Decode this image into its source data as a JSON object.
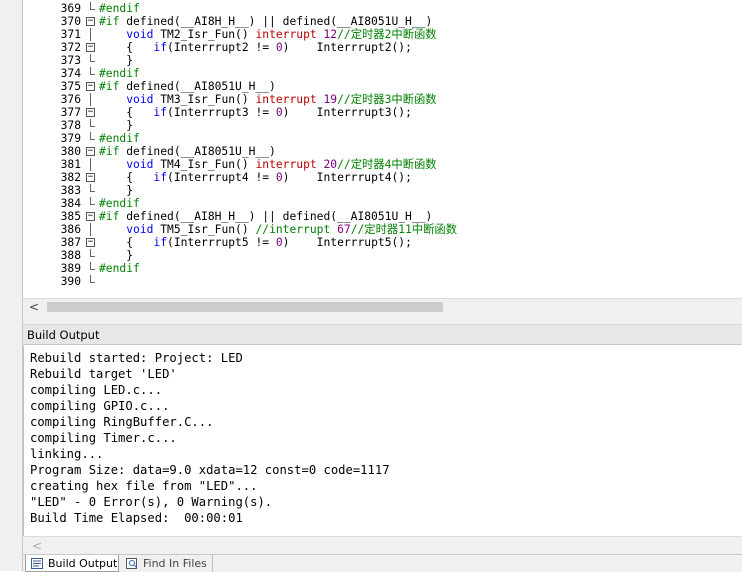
{
  "editor": {
    "lines": [
      {
        "num": "369",
        "code": [
          {
            "t": "#endif",
            "c": "pp"
          }
        ]
      },
      {
        "num": "370",
        "code": [
          {
            "t": "#if",
            "c": "pp"
          },
          {
            "t": " defined(__AI8H_H__) || defined(__AI8051U_H__)"
          }
        ]
      },
      {
        "num": "371",
        "code": [
          {
            "t": "    "
          },
          {
            "t": "void",
            "c": "kw"
          },
          {
            "t": " TM2_Isr_Fun() "
          },
          {
            "t": "interrupt",
            "c": "ir"
          },
          {
            "t": " "
          },
          {
            "t": "12",
            "c": "num"
          },
          {
            "t": "//定时器2中断函数",
            "c": "cmt"
          }
        ]
      },
      {
        "num": "372",
        "code": [
          {
            "t": "    {   "
          },
          {
            "t": "if",
            "c": "kw"
          },
          {
            "t": "(Interrrupt2 != "
          },
          {
            "t": "0",
            "c": "num"
          },
          {
            "t": ")    Interrrupt2();"
          }
        ]
      },
      {
        "num": "373",
        "code": [
          {
            "t": "    }"
          }
        ]
      },
      {
        "num": "374",
        "code": [
          {
            "t": "#endif",
            "c": "pp"
          }
        ]
      },
      {
        "num": "375",
        "code": [
          {
            "t": "#if",
            "c": "pp"
          },
          {
            "t": " defined(__AI8051U_H__)"
          }
        ]
      },
      {
        "num": "376",
        "code": [
          {
            "t": "    "
          },
          {
            "t": "void",
            "c": "kw"
          },
          {
            "t": " TM3_Isr_Fun() "
          },
          {
            "t": "interrupt",
            "c": "ir"
          },
          {
            "t": " "
          },
          {
            "t": "19",
            "c": "num"
          },
          {
            "t": "//定时器3中断函数",
            "c": "cmt"
          }
        ]
      },
      {
        "num": "377",
        "code": [
          {
            "t": "    {   "
          },
          {
            "t": "if",
            "c": "kw"
          },
          {
            "t": "(Interrrupt3 != "
          },
          {
            "t": "0",
            "c": "num"
          },
          {
            "t": ")    Interrrupt3();"
          }
        ]
      },
      {
        "num": "378",
        "code": [
          {
            "t": "    }"
          }
        ]
      },
      {
        "num": "379",
        "code": [
          {
            "t": "#endif",
            "c": "pp"
          }
        ]
      },
      {
        "num": "380",
        "code": [
          {
            "t": "#if",
            "c": "pp"
          },
          {
            "t": " defined(__AI8051U_H__)"
          }
        ]
      },
      {
        "num": "381",
        "code": [
          {
            "t": "    "
          },
          {
            "t": "void",
            "c": "kw"
          },
          {
            "t": " TM4_Isr_Fun() "
          },
          {
            "t": "interrupt",
            "c": "ir"
          },
          {
            "t": " "
          },
          {
            "t": "20",
            "c": "num"
          },
          {
            "t": "//定时器4中断函数",
            "c": "cmt"
          }
        ]
      },
      {
        "num": "382",
        "code": [
          {
            "t": "    {   "
          },
          {
            "t": "if",
            "c": "kw"
          },
          {
            "t": "(Interrrupt4 != "
          },
          {
            "t": "0",
            "c": "num"
          },
          {
            "t": ")    Interrrupt4();"
          }
        ]
      },
      {
        "num": "383",
        "code": [
          {
            "t": "    }"
          }
        ]
      },
      {
        "num": "384",
        "code": [
          {
            "t": "#endif",
            "c": "pp"
          }
        ]
      },
      {
        "num": "385",
        "code": [
          {
            "t": "#if",
            "c": "pp"
          },
          {
            "t": " defined(__AI8H_H__) || defined(__AI8051U_H__)"
          }
        ]
      },
      {
        "num": "386",
        "code": [
          {
            "t": "    "
          },
          {
            "t": "void",
            "c": "kw"
          },
          {
            "t": " TM5_Isr_Fun() "
          },
          {
            "t": "//interrupt ",
            "c": "cmt"
          },
          {
            "t": "67",
            "c": "num"
          },
          {
            "t": "//定时器11中断函数",
            "c": "cmt"
          }
        ]
      },
      {
        "num": "387",
        "code": [
          {
            "t": "    {   "
          },
          {
            "t": "if",
            "c": "kw"
          },
          {
            "t": "(Interrrupt5 != "
          },
          {
            "t": "0",
            "c": "num"
          },
          {
            "t": ")    Interrrupt5();"
          }
        ]
      },
      {
        "num": "388",
        "code": [
          {
            "t": "    }"
          }
        ]
      },
      {
        "num": "389",
        "code": [
          {
            "t": "#endif",
            "c": "pp"
          }
        ]
      },
      {
        "num": "390",
        "code": []
      }
    ],
    "folds": [
      "end",
      "open",
      "",
      "open",
      "end",
      "end",
      "open",
      "",
      "open",
      "end",
      "end",
      "open",
      "",
      "open",
      "end",
      "end",
      "open",
      "",
      "open",
      "end",
      "end",
      "end"
    ]
  },
  "build_output": {
    "title": "Build Output",
    "lines": [
      "Rebuild started: Project: LED",
      "Rebuild target 'LED'",
      "compiling LED.c...",
      "compiling GPIO.c...",
      "compiling RingBuffer.C...",
      "compiling Timer.c...",
      "linking...",
      "Program Size: data=9.0 xdata=12 const=0 code=1117",
      "creating hex file from \"LED\"...",
      "\"LED\" - 0 Error(s), 0 Warning(s).",
      "Build Time Elapsed:  00:00:01"
    ]
  },
  "tabs": [
    {
      "label": "Build Output",
      "active": true,
      "icon": "build-output-icon"
    },
    {
      "label": "Find In Files",
      "active": false,
      "icon": "find-in-files-icon"
    }
  ],
  "scroll_left_glyph": "<",
  "colors": {
    "preprocessor": "#008000",
    "keyword": "#0000ff",
    "number": "#800080",
    "comment": "#008000",
    "interrupt": "#b80000"
  }
}
